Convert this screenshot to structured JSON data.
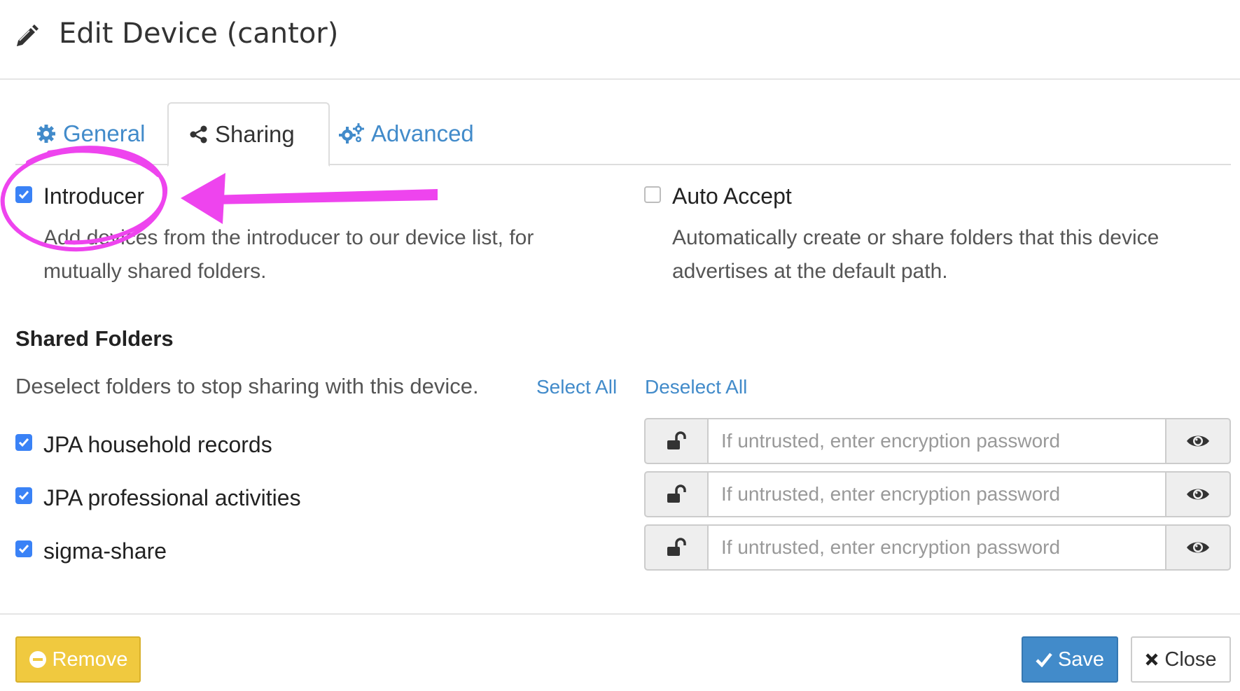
{
  "header": {
    "title": "Edit Device (cantor)",
    "icon": "pencil-icon"
  },
  "tabs": [
    {
      "label": "General",
      "icon": "gear-icon",
      "active": false
    },
    {
      "label": "Sharing",
      "icon": "share-icon",
      "active": true
    },
    {
      "label": "Advanced",
      "icon": "gears-icon",
      "active": false
    }
  ],
  "introducer": {
    "label": "Introducer",
    "checked": true,
    "help_line1": "Add devices from the introducer to our device list, for",
    "help_line2": "mutually shared folders."
  },
  "auto_accept": {
    "label": "Auto Accept",
    "checked": false,
    "help_line1": "Automatically create or share folders that this device",
    "help_line2": "advertises at the default path."
  },
  "shared_folders": {
    "title": "Shared Folders",
    "hint": "Deselect folders to stop sharing with this device.",
    "select_all": "Select All",
    "deselect_all": "Deselect All",
    "folders": [
      {
        "label": "JPA household records",
        "checked": true,
        "password_placeholder": "If untrusted, enter encryption password"
      },
      {
        "label": "JPA professional activities",
        "checked": true,
        "password_placeholder": "If untrusted, enter encryption password"
      },
      {
        "label": "sigma-share",
        "checked": true,
        "password_placeholder": "If untrusted, enter encryption password"
      }
    ]
  },
  "footer": {
    "remove_label": "Remove",
    "save_label": "Save",
    "close_label": "Close"
  },
  "colors": {
    "link": "#428bca",
    "checkbox": "#3a82f6",
    "remove_button": "#f0c93f",
    "save_button": "#428bca",
    "annotation": "#ee44ee"
  }
}
